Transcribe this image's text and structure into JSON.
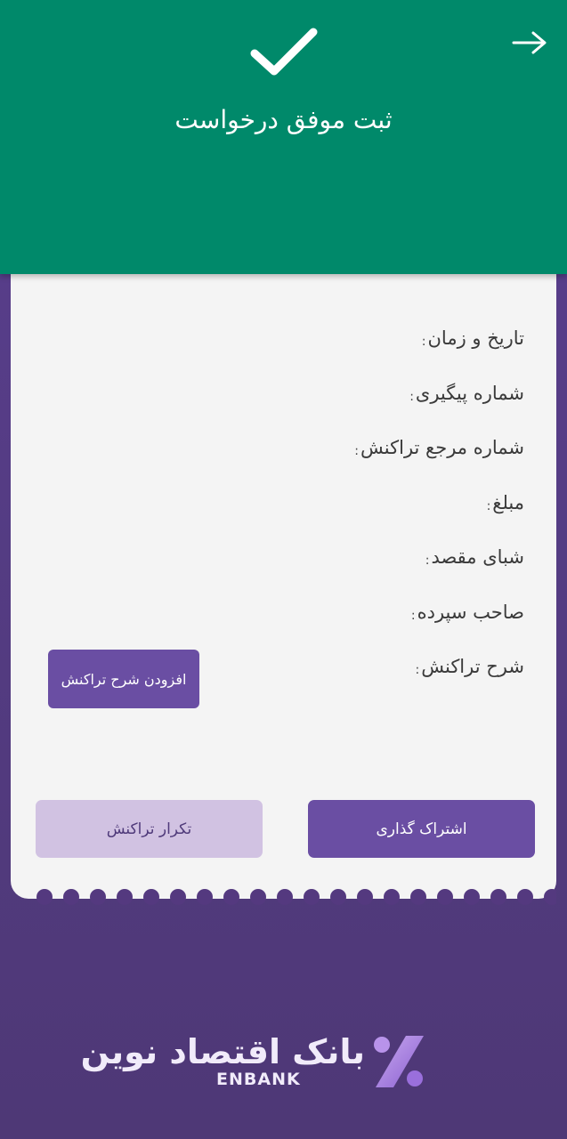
{
  "header": {
    "title": "ثبت موفق درخواست",
    "back_icon": "arrow-right-icon",
    "status_icon": "check-icon",
    "color": "#00896a"
  },
  "receipt": {
    "fields": [
      {
        "label": "تاریخ و زمان",
        "colon": ":"
      },
      {
        "label": "شماره پیگیری",
        "colon": ":"
      },
      {
        "label": "شماره مرجع تراکنش",
        "colon": ":"
      },
      {
        "label": "مبلغ",
        "colon": ":"
      },
      {
        "label": "شبای مقصد",
        "colon": ":"
      },
      {
        "label": "صاحب سپرده",
        "colon": ":"
      },
      {
        "label": "شرح تراکنش",
        "colon": ":"
      }
    ],
    "add_description_label": "افزودن شرح تراکنش"
  },
  "actions": {
    "share_label": "اشتراک گذاری",
    "repeat_label": "تکرار تراکنش"
  },
  "brand": {
    "name_fa": "بانک اقتصاد نوین",
    "name_en": "ENBANK",
    "accent": "#6a4ea3"
  }
}
